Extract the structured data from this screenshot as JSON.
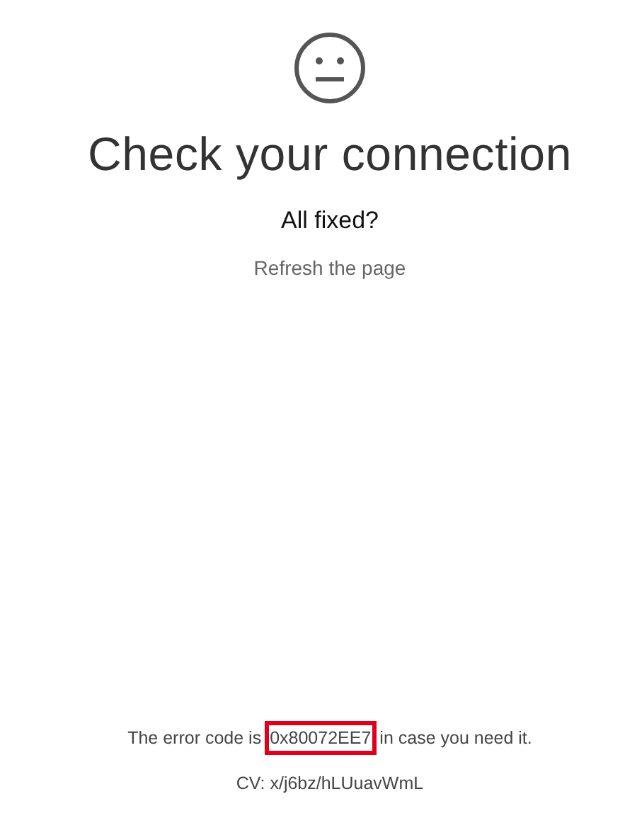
{
  "title": "Check your connection",
  "subtitle": "All fixed?",
  "refresh_link": "Refresh the page",
  "error": {
    "prefix": "The error code is",
    "code": "0x80072EE7",
    "suffix": "in case you need it.",
    "highlighted": true
  },
  "cv": "CV: x/j6bz/hLUuavWmL"
}
